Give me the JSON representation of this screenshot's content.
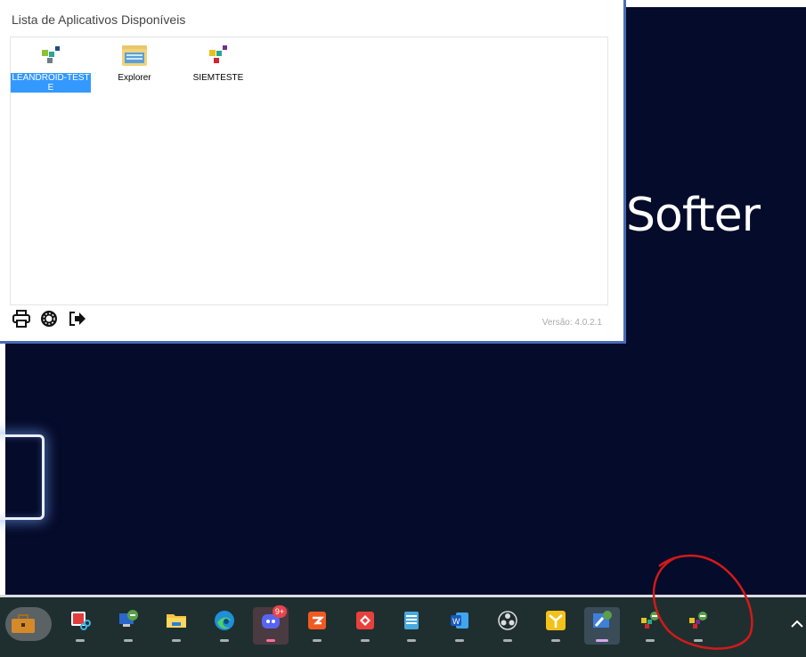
{
  "window": {
    "title": "Lista de Aplicativos Disponíveis",
    "version": "Versão: 4.0.2.1"
  },
  "apps": [
    {
      "label": "LEANDROID-TESTE",
      "selected": true,
      "icon": "app-grid-icon"
    },
    {
      "label": "Explorer",
      "selected": false,
      "icon": "explorer-folder-icon"
    },
    {
      "label": "SIEMTESTE",
      "selected": false,
      "icon": "app-grid-icon"
    }
  ],
  "footer_icons": [
    "print-icon",
    "settings-icon",
    "exit-icon"
  ],
  "desktop": {
    "brand_text": "Softer"
  },
  "taskbar": {
    "items": [
      {
        "name": "briefcase-app",
        "icon": "briefcase-icon"
      },
      {
        "name": "snipping-tool",
        "icon": "scissors-icon"
      },
      {
        "name": "remote-desktop-1",
        "icon": "remote-desktop-icon"
      },
      {
        "name": "file-explorer",
        "icon": "folder-icon"
      },
      {
        "name": "edge",
        "icon": "edge-icon"
      },
      {
        "name": "discord",
        "icon": "discord-icon",
        "badge": "9+"
      },
      {
        "name": "app-orange",
        "icon": "orange-app-icon"
      },
      {
        "name": "anydesk",
        "icon": "anydesk-icon"
      },
      {
        "name": "notepad",
        "icon": "notepad-icon"
      },
      {
        "name": "word",
        "icon": "word-icon"
      },
      {
        "name": "obs",
        "icon": "obs-icon"
      },
      {
        "name": "app-yellow",
        "icon": "yellow-app-icon"
      },
      {
        "name": "remote-app-active",
        "icon": "remote-app-icon"
      },
      {
        "name": "remote-app-2",
        "icon": "remote-app-icon"
      },
      {
        "name": "remote-app-3",
        "icon": "remote-app-icon"
      }
    ],
    "overflow_icon": "chevron-up-icon"
  },
  "colors": {
    "desktop_bg": "#050b2a",
    "taskbar_bg": "#1f2f2f",
    "selection": "#3399ff",
    "window_border": "#4a6bb8",
    "annotation": "#d11a1a"
  }
}
